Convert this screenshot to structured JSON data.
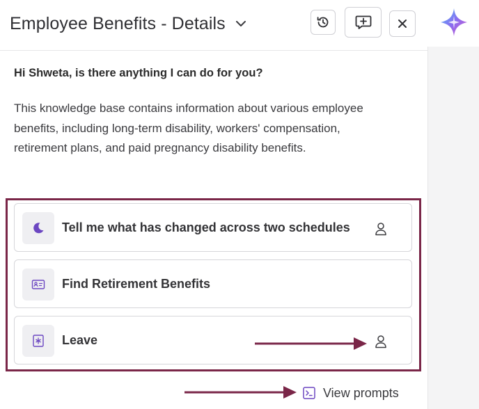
{
  "header": {
    "title": "Employee Benefits - Details",
    "icons": {
      "chevron": "chevron-down-icon",
      "history": "history-icon",
      "new_chat": "new-chat-icon",
      "close": "close-icon",
      "assistant": "sparkle-icon"
    }
  },
  "chat": {
    "greeting": "Hi Shweta, is there anything I can do for you?",
    "intro": "This knowledge base contains information about various employee benefits, including long-term disability, workers' compensation, retirement plans, and paid pregnancy disability benefits."
  },
  "prompts": [
    {
      "label": "Tell me what has changed across two schedules",
      "icon": "moon-icon",
      "has_user_icon": true
    },
    {
      "label": "Find Retirement Benefits",
      "icon": "id-card-icon",
      "has_user_icon": false
    },
    {
      "label": "Leave",
      "icon": "leave-icon",
      "has_user_icon": true
    }
  ],
  "footer": {
    "view_prompts_label": "View prompts",
    "icon": "terminal-icon"
  },
  "colors": {
    "highlight_border": "#7a2648",
    "annotation_arrow": "#7a2648",
    "icon_purple": "#6b46c1"
  }
}
